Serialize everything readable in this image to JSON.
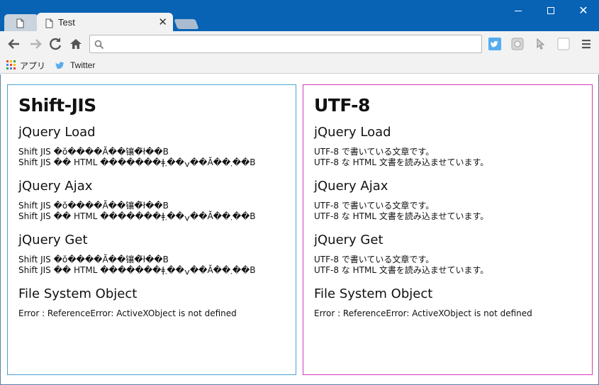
{
  "browser": {
    "tab_active_title": "Test",
    "tab_close_glyph": "✕",
    "address_value": "",
    "bookmarks": [
      {
        "label": "アプリ",
        "icon": "apps-grid-icon"
      },
      {
        "label": "Twitter",
        "icon": "twitter-bird-icon"
      }
    ],
    "colors": {
      "titlebar": "#0863b5",
      "toolbar": "#f2f2f2",
      "left_border": "#4ca3cf",
      "right_border": "#d23bb5"
    }
  },
  "panels": {
    "left": {
      "title": "Shift-JIS",
      "sections": [
        {
          "heading": "jQuery Load",
          "line1": "Shift JIS �ŏ����Ă��镶�͂ł��B",
          "line2": "Shift JIS �� HTML �������ǂݍ��܂��Ă��܂��B"
        },
        {
          "heading": "jQuery Ajax",
          "line1": "Shift JIS �ŏ����Ă��镶�͂ł��B",
          "line2": "Shift JIS �� HTML �������ǂݍ��܂��Ă��܂��B"
        },
        {
          "heading": "jQuery Get",
          "line1": "Shift JIS �ŏ����Ă��镶�͂ł��B",
          "line2": "Shift JIS �� HTML �������ǂݍ��܂��Ă��܂��B"
        }
      ],
      "fso_heading": "File System Object",
      "fso_error": "Error : ReferenceError: ActiveXObject is not defined"
    },
    "right": {
      "title": "UTF-8",
      "sections": [
        {
          "heading": "jQuery Load",
          "line1": "UTF-8 で書いている文章です。",
          "line2": "UTF-8 な HTML 文書を読み込ませています。"
        },
        {
          "heading": "jQuery Ajax",
          "line1": "UTF-8 で書いている文章です。",
          "line2": "UTF-8 な HTML 文書を読み込ませています。"
        },
        {
          "heading": "jQuery Get",
          "line1": "UTF-8 で書いている文章です。",
          "line2": "UTF-8 な HTML 文書を読み込ませています。"
        }
      ],
      "fso_heading": "File System Object",
      "fso_error": "Error : ReferenceError: ActiveXObject is not defined"
    }
  }
}
